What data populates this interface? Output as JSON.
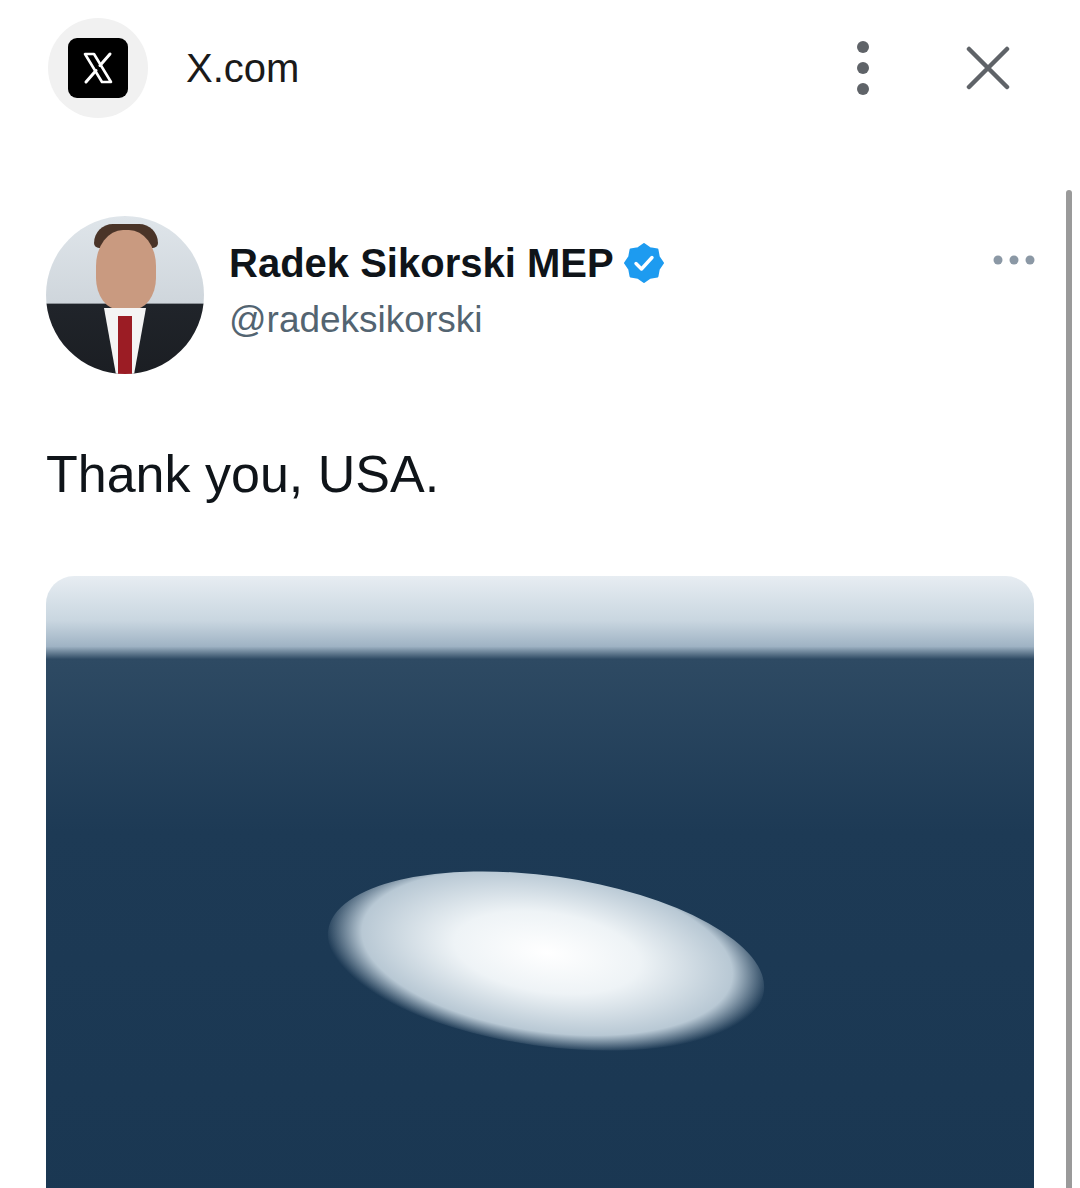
{
  "browser": {
    "title": "X.com"
  },
  "tweet": {
    "author": {
      "name": "Radek Sikorski MEP",
      "handle": "@radeksikorski",
      "verified": true
    },
    "text": "Thank you, USA."
  }
}
